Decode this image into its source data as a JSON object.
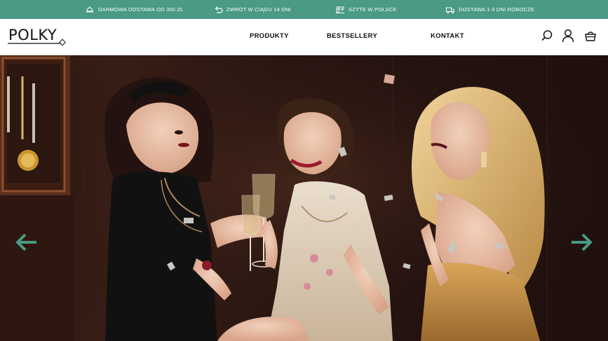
{
  "promo": {
    "items": [
      {
        "icon": "free-delivery-icon",
        "label": "DARMOWA DOSTAWA OD 300 ZŁ"
      },
      {
        "icon": "return-arrow-icon",
        "label": "ZWROT W CIĄGU 14 DNI"
      },
      {
        "icon": "sewing-machine-icon",
        "label": "SZYTE W POLSCE"
      },
      {
        "icon": "delivery-truck-icon",
        "label": "DOSTAWA 1-3 DNI ROBOCZE"
      }
    ],
    "background": "#4a9a85"
  },
  "header": {
    "logo": "POLKY",
    "nav": [
      "PRODUKTY",
      "BESTSELLERY",
      "KONTAKT"
    ],
    "icons": [
      "search-icon",
      "user-icon",
      "cart-icon"
    ]
  },
  "hero": {
    "image": "three-women-in-party-dresses-photo",
    "prev_icon": "arrow-left-icon",
    "next_icon": "arrow-right-icon",
    "arrow_color": "#4a9a85"
  }
}
